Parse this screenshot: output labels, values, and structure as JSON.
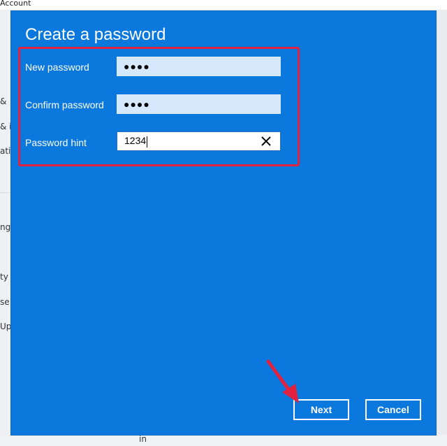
{
  "background": {
    "window_title": "Account",
    "sidebar_fragments": [
      "&",
      "& i",
      "ati",
      "ng",
      "ty",
      "se",
      "Up"
    ],
    "bottom_fragment": "in"
  },
  "dialog": {
    "title": "Create a password",
    "fields": {
      "new_password": {
        "label": "New password",
        "value_masked": "●●●●"
      },
      "confirm_password": {
        "label": "Confirm password",
        "value_masked": "●●●●"
      },
      "password_hint": {
        "label": "Password hint",
        "value": "1234"
      }
    },
    "buttons": {
      "next": "Next",
      "cancel": "Cancel"
    }
  },
  "colors": {
    "dialog_background": "#0a78dc",
    "highlight_border": "#e0213f",
    "annotation_arrow": "#e0213f"
  },
  "icons": {
    "clear": "close-icon",
    "annotation": "arrow-annotation"
  }
}
